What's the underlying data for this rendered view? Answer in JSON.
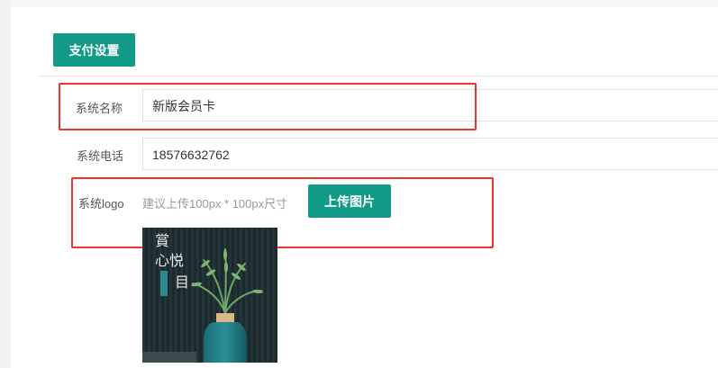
{
  "toolbar": {
    "pay_settings_label": "支付设置"
  },
  "form": {
    "system_name": {
      "label": "系统名称",
      "value": "新版会员卡"
    },
    "system_phone": {
      "label": "系统电话",
      "value": "18576632762"
    },
    "system_logo": {
      "label": "系统logo",
      "hint": "建议上传100px * 100px尺寸",
      "upload_label": "上传图片"
    }
  },
  "logo_image": {
    "line1": "賞",
    "line2": "心悦",
    "line3": "目"
  },
  "colors": {
    "accent": "#119a86",
    "highlight": "#e8342b"
  }
}
